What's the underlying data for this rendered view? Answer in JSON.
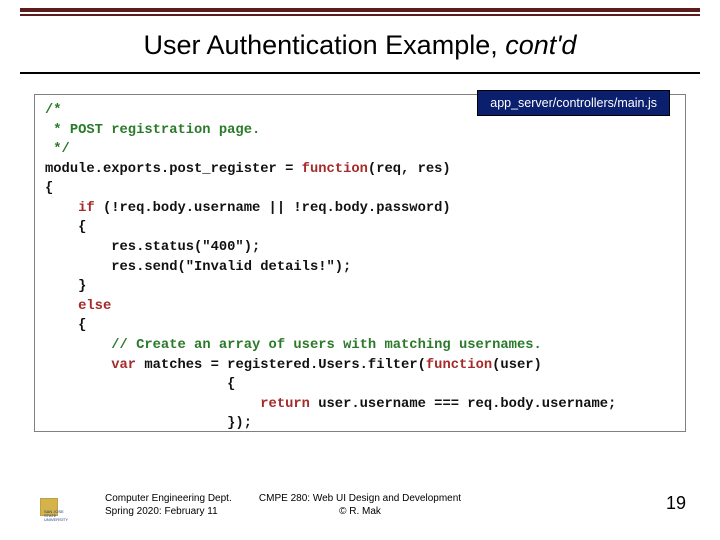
{
  "title": {
    "main": "User Authentication Example, ",
    "contd": "cont'd"
  },
  "file_badge": "app_server/controllers/main.js",
  "code": {
    "l01": "/*",
    "l02": " * POST registration page.",
    "l03": " */",
    "l04a": "module.exports.post_register = ",
    "l04b": "function",
    "l04c": "(req, res)",
    "l05": "{",
    "l06a": "    ",
    "l06b": "if",
    "l06c": " (!req.body.username || !req.body.password)",
    "l07": "    {",
    "l08": "        res.status(\"400\");",
    "l09": "        res.send(\"Invalid details!\");",
    "l10": "    }",
    "l11a": "    ",
    "l11b": "else",
    "l12": "    {",
    "l13a": "        ",
    "l13b": "// Create an array of users with matching usernames.",
    "l14a": "        ",
    "l14b": "var",
    "l14c": " matches = registered.Users.filter(",
    "l14d": "function",
    "l14e": "(user)",
    "l15": "                      {",
    "l16a": "                          ",
    "l16b": "return",
    "l16c": " user.username === req.body.username;",
    "l17": "                      });"
  },
  "footer": {
    "left_line1": "Computer Engineering Dept.",
    "left_line2": "Spring 2020: February 11",
    "center_line1": "CMPE 280: Web UI Design and Development",
    "center_line2": "© R. Mak",
    "page": "19",
    "logo_text": "SAN JOSE STATE UNIVERSITY"
  }
}
